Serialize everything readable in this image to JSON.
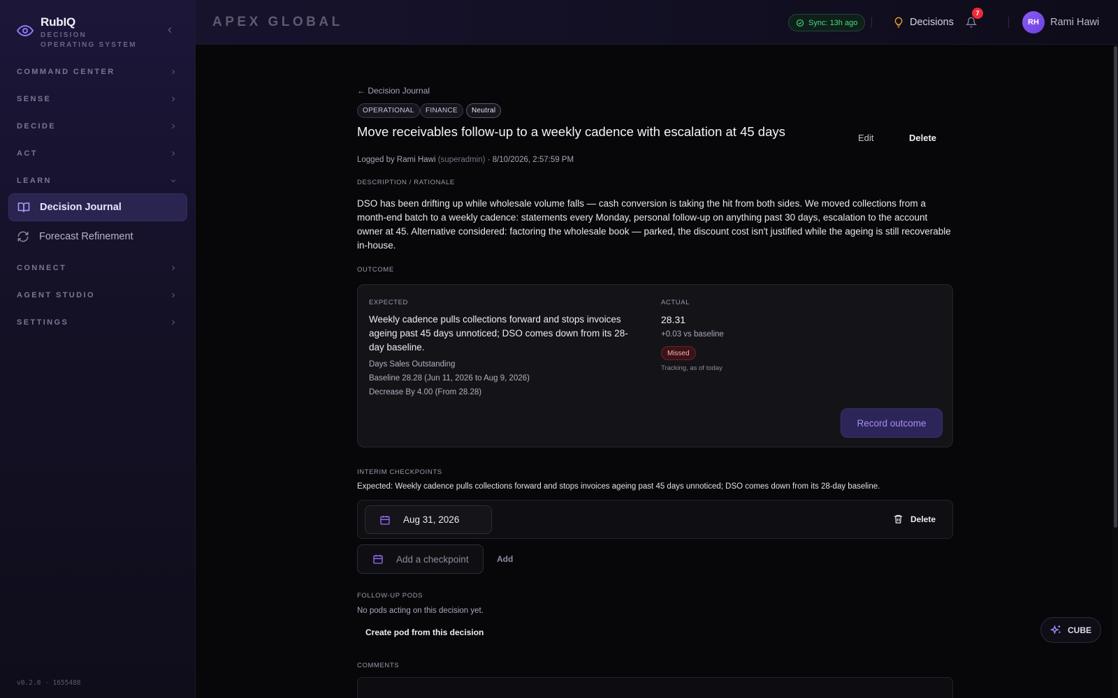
{
  "app": {
    "name": "RubIQ",
    "subtitle": "DECISION OPERATING SYSTEM",
    "version": "v0.2.0 · 1655488"
  },
  "sidebar": {
    "sections": [
      {
        "label": "COMMAND CENTER",
        "expanded": false
      },
      {
        "label": "SENSE",
        "expanded": false
      },
      {
        "label": "DECIDE",
        "expanded": false
      },
      {
        "label": "ACT",
        "expanded": false
      },
      {
        "label": "LEARN",
        "expanded": true
      },
      {
        "label": "CONNECT",
        "expanded": false
      },
      {
        "label": "AGENT STUDIO",
        "expanded": false
      },
      {
        "label": "SETTINGS",
        "expanded": false
      }
    ],
    "learn_items": [
      {
        "label": "Decision Journal",
        "icon": "book-icon",
        "active": true
      },
      {
        "label": "Forecast Refinement",
        "icon": "refresh-icon",
        "active": false
      }
    ]
  },
  "topbar": {
    "company": "APEX GLOBAL",
    "sync": "Sync: 13h ago",
    "decisions": "Decisions",
    "notifications": "7",
    "avatar_initials": "RH",
    "user_name": "Rami Hawi"
  },
  "decision": {
    "back": "← Decision Journal",
    "tags": [
      "OPERATIONAL",
      "FINANCE",
      "Neutral"
    ],
    "title": "Move receivables follow-up to a weekly cadence with escalation at 45 days",
    "edit": "Edit",
    "delete": "Delete",
    "logged_prefix": "Logged by Rami Hawi",
    "logged_role": "(superadmin)",
    "logged_suffix": "· 8/10/2026, 2:57:59 PM",
    "description_label": "DESCRIPTION / RATIONALE",
    "description": "DSO has been drifting up while wholesale volume falls — cash conversion is taking the hit from both sides. We moved collections from a month-end batch to a weekly cadence: statements every Monday, personal follow-up on anything past 30 days, escalation to the account owner at 45. Alternative considered: factoring the wholesale book — parked, the discount cost isn't justified while the ageing is still recoverable in-house."
  },
  "outcome": {
    "label": "OUTCOME",
    "expected_label": "EXPECTED",
    "expected_text": "Weekly cadence pulls collections forward and stops invoices ageing past 45 days unnoticed; DSO comes down from its 28-day baseline.",
    "metric": "Days Sales Outstanding",
    "baseline": "Baseline 28.28 (Jun 11, 2026 to Aug 9, 2026)",
    "target": "Decrease By 4.00 (From 28.28)",
    "actual_label": "ACTUAL",
    "actual_value": "28.31",
    "actual_delta": "+0.03 vs baseline",
    "status": "Missed",
    "tracking": "Tracking, as of today",
    "record_button": "Record outcome"
  },
  "checkpoints": {
    "label": "INTERIM CHECKPOINTS",
    "expected": "Expected: Weekly cadence pulls collections forward and stops invoices ageing past 45 days unnoticed; DSO comes down from its 28-day baseline.",
    "items": [
      {
        "date": "Aug 31, 2026",
        "delete": "Delete"
      }
    ],
    "add_placeholder": "Add a checkpoint",
    "add_button": "Add"
  },
  "followup": {
    "label": "FOLLOW-UP PODS",
    "empty": "No pods acting on this decision yet.",
    "create": "Create pod from this decision"
  },
  "comments": {
    "label": "COMMENTS"
  },
  "cube": {
    "label": "CUBE"
  },
  "colors": {
    "accent": "#8b5cf6",
    "success": "#4ade80",
    "danger": "#ef2b3a"
  }
}
